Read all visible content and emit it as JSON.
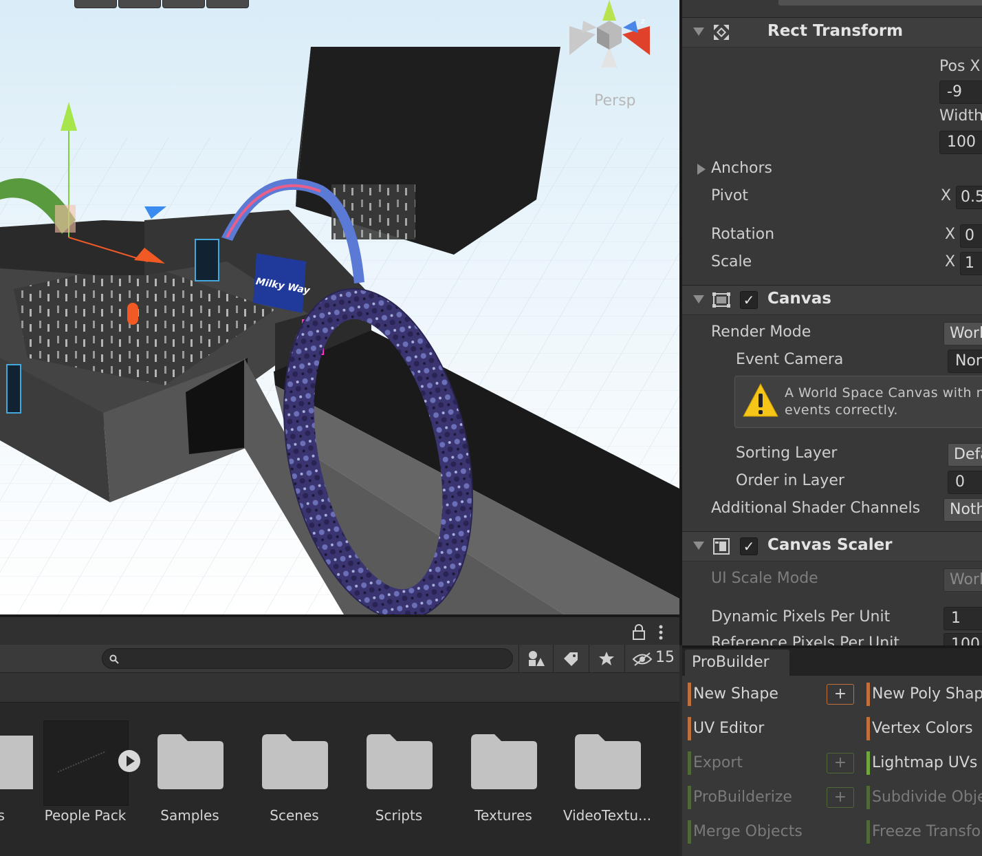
{
  "scene": {
    "projection_label": "Persp"
  },
  "inspector": {
    "rect_transform": {
      "title": "Rect Transform",
      "pos_x_label": "Pos X",
      "pos_x_value": "-9",
      "width_label": "Width",
      "width_value": "100",
      "anchors_label": "Anchors",
      "pivot_label": "Pivot",
      "pivot_x_label": "X",
      "pivot_x_value": "0.5",
      "rotation_label": "Rotation",
      "rotation_x_label": "X",
      "rotation_x_value": "0",
      "scale_label": "Scale",
      "scale_x_label": "X",
      "scale_x_value": "1"
    },
    "canvas": {
      "title": "Canvas",
      "render_mode_label": "Render Mode",
      "render_mode_value": "Worl",
      "event_camera_label": "Event Camera",
      "event_camera_value": "Non",
      "warning_text": "A World Space Canvas with no\nevents correctly.",
      "sorting_layer_label": "Sorting Layer",
      "sorting_layer_value": "Defa",
      "order_in_layer_label": "Order in Layer",
      "order_in_layer_value": "0",
      "shader_channels_label": "Additional Shader Channels",
      "shader_channels_value": "Noth"
    },
    "canvas_scaler": {
      "title": "Canvas Scaler",
      "ui_scale_mode_label": "UI Scale Mode",
      "ui_scale_mode_value": "Worl",
      "dynamic_ppu_label": "Dynamic Pixels Per Unit",
      "dynamic_ppu_value": "1",
      "reference_ppu_label": "Reference Pixels Per Unit",
      "reference_ppu_value": "100"
    }
  },
  "project": {
    "hidden_count": "15",
    "items": [
      {
        "label": "ls",
        "kind": "folder-partial"
      },
      {
        "label": "People Pack",
        "kind": "prefab"
      },
      {
        "label": "Samples",
        "kind": "folder"
      },
      {
        "label": "Scenes",
        "kind": "folder"
      },
      {
        "label": "Scripts",
        "kind": "folder"
      },
      {
        "label": "Textures",
        "kind": "folder"
      },
      {
        "label": "VideoTextu...",
        "kind": "folder"
      }
    ]
  },
  "probuilder": {
    "tab_label": "ProBuilder",
    "left_buttons": [
      {
        "label": "New Shape",
        "enabled": true,
        "color": "#c0703a",
        "has_options": true
      },
      {
        "label": "UV Editor",
        "enabled": true,
        "color": "#c0703a",
        "has_options": false
      },
      {
        "label": "Export",
        "enabled": false,
        "color": "#4f6a34",
        "has_options": true
      },
      {
        "label": "ProBuilderize",
        "enabled": false,
        "color": "#4f6a34",
        "has_options": true
      },
      {
        "label": "Merge Objects",
        "enabled": false,
        "color": "#4f6a34",
        "has_options": false
      }
    ],
    "right_buttons": [
      {
        "label": "New Poly Shape",
        "enabled": true,
        "color": "#c0703a"
      },
      {
        "label": "Vertex Colors",
        "enabled": true,
        "color": "#c0703a"
      },
      {
        "label": "Lightmap UVs",
        "enabled": true,
        "color": "#6fa83e"
      },
      {
        "label": "Subdivide Objects",
        "enabled": false,
        "color": "#4f6a34"
      },
      {
        "label": "Freeze Transform",
        "enabled": false,
        "color": "#4f6a34"
      }
    ]
  },
  "colors": {
    "panel_bg": "#383838",
    "scene_sky": "#ffffff",
    "accent_orange": "#c0703a",
    "accent_green": "#6fa83e",
    "warning_yellow": "#f5c518"
  }
}
